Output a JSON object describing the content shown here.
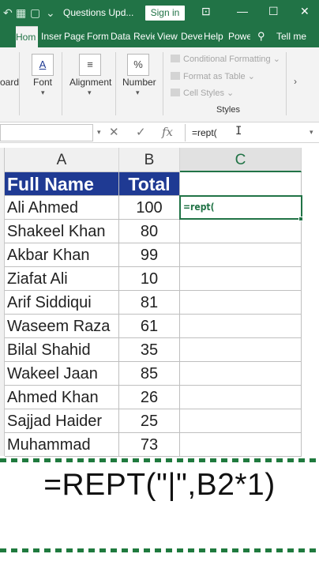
{
  "titlebar": {
    "title": "Questions Upd...",
    "signin_label": "Sign in"
  },
  "tabs": [
    {
      "label": "Hom",
      "active": true
    },
    {
      "label": "Inser"
    },
    {
      "label": "Page"
    },
    {
      "label": "Form"
    },
    {
      "label": "Data"
    },
    {
      "label": "Revie"
    },
    {
      "label": "View"
    },
    {
      "label": "Deve"
    },
    {
      "label": "Help"
    },
    {
      "label": "Powe"
    },
    {
      "label": "Tell me"
    }
  ],
  "ribbon": {
    "clipboard_label": "oard",
    "font_label": "Font",
    "font_icon_letter": "A",
    "alignment_label": "Alignment",
    "number_label": "Number",
    "number_icon": "%",
    "styles_items": [
      "Conditional Formatting",
      "Format as Table",
      "Cell Styles"
    ],
    "styles_label": "Styles"
  },
  "formula_bar": {
    "value": "=rept("
  },
  "columns": [
    "A",
    "B",
    "C"
  ],
  "table": {
    "headers": [
      "Full Name",
      "Total"
    ],
    "rows": [
      {
        "name": "Ali Ahmed",
        "total": "100"
      },
      {
        "name": "Shakeel Khan",
        "total": "80"
      },
      {
        "name": "Akbar Khan",
        "total": "99"
      },
      {
        "name": "Ziafat Ali",
        "total": "10"
      },
      {
        "name": "Arif Siddiqui",
        "total": "81"
      },
      {
        "name": "Waseem Raza",
        "total": "61"
      },
      {
        "name": "Bilal Shahid",
        "total": "35"
      },
      {
        "name": "Wakeel Jaan",
        "total": "85"
      },
      {
        "name": "Ahmed Khan",
        "total": "26"
      },
      {
        "name": "Sajjad Haider",
        "total": "25"
      },
      {
        "name": "Muhammad",
        "total": "73"
      }
    ]
  },
  "active_cell_text": "=rept(",
  "caption": "=REPT(\"|\",B2*1)",
  "colors": {
    "excel_green": "#217346",
    "header_fill": "#1f3a93"
  }
}
